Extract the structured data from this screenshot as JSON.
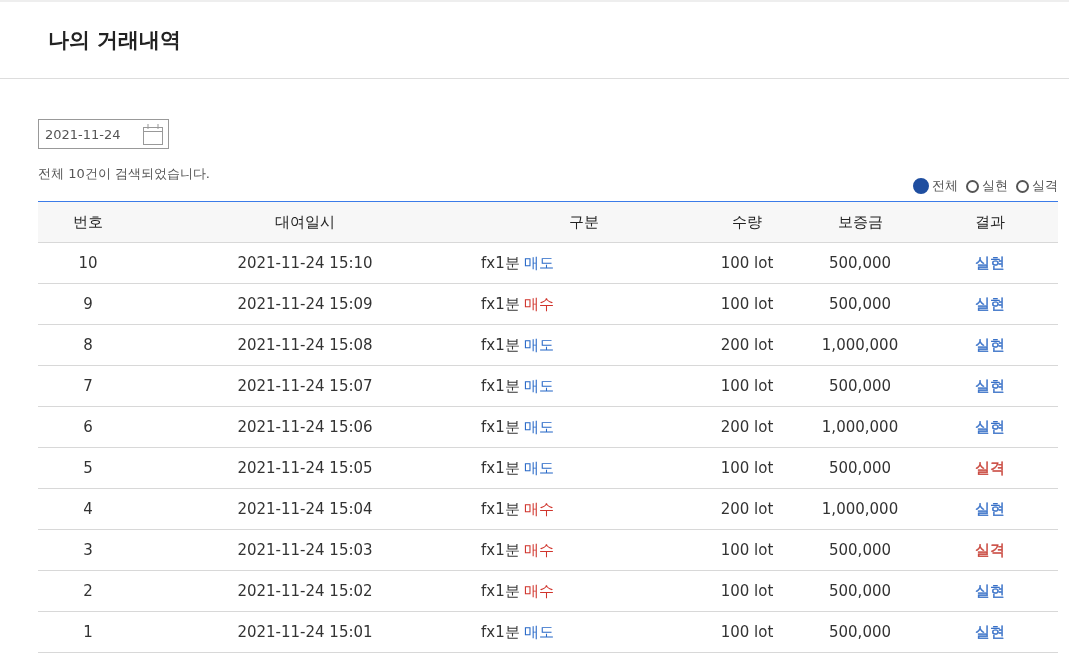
{
  "page_title": "나의 거래내역",
  "date_field": {
    "value": "2021-11-24"
  },
  "result_count": "전체 10건이 검색되었습니다.",
  "filters": [
    {
      "label": "전체",
      "selected": true
    },
    {
      "label": "실현",
      "selected": false
    },
    {
      "label": "실격",
      "selected": false
    }
  ],
  "table": {
    "columns": [
      "번호",
      "대여일시",
      "구분",
      "수량",
      "보증금",
      "결과"
    ],
    "rows": [
      {
        "no": "10",
        "datetime": "2021-11-24 15:10",
        "product": "fx1분",
        "side": {
          "text": "매도",
          "color": "#2a6ac8"
        },
        "quantity": "100 lot",
        "deposit": "500,000",
        "result": {
          "text": "실현",
          "color": "#3a72c8"
        }
      },
      {
        "no": "9",
        "datetime": "2021-11-24 15:09",
        "product": "fx1분",
        "side": {
          "text": "매수",
          "color": "#d0342c"
        },
        "quantity": "100 lot",
        "deposit": "500,000",
        "result": {
          "text": "실현",
          "color": "#3a72c8"
        }
      },
      {
        "no": "8",
        "datetime": "2021-11-24 15:08",
        "product": "fx1분",
        "side": {
          "text": "매도",
          "color": "#2a6ac8"
        },
        "quantity": "200 lot",
        "deposit": "1,000,000",
        "result": {
          "text": "실현",
          "color": "#3a72c8"
        }
      },
      {
        "no": "7",
        "datetime": "2021-11-24 15:07",
        "product": "fx1분",
        "side": {
          "text": "매도",
          "color": "#2a6ac8"
        },
        "quantity": "100 lot",
        "deposit": "500,000",
        "result": {
          "text": "실현",
          "color": "#3a72c8"
        }
      },
      {
        "no": "6",
        "datetime": "2021-11-24 15:06",
        "product": "fx1분",
        "side": {
          "text": "매도",
          "color": "#2a6ac8"
        },
        "quantity": "200 lot",
        "deposit": "1,000,000",
        "result": {
          "text": "실현",
          "color": "#3a72c8"
        }
      },
      {
        "no": "5",
        "datetime": "2021-11-24 15:05",
        "product": "fx1분",
        "side": {
          "text": "매도",
          "color": "#2a6ac8"
        },
        "quantity": "100 lot",
        "deposit": "500,000",
        "result": {
          "text": "실격",
          "color": "#c8443a"
        }
      },
      {
        "no": "4",
        "datetime": "2021-11-24 15:04",
        "product": "fx1분",
        "side": {
          "text": "매수",
          "color": "#d0342c"
        },
        "quantity": "200 lot",
        "deposit": "1,000,000",
        "result": {
          "text": "실현",
          "color": "#3a72c8"
        }
      },
      {
        "no": "3",
        "datetime": "2021-11-24 15:03",
        "product": "fx1분",
        "side": {
          "text": "매수",
          "color": "#d0342c"
        },
        "quantity": "100 lot",
        "deposit": "500,000",
        "result": {
          "text": "실격",
          "color": "#c8443a"
        }
      },
      {
        "no": "2",
        "datetime": "2021-11-24 15:02",
        "product": "fx1분",
        "side": {
          "text": "매수",
          "color": "#d0342c"
        },
        "quantity": "100 lot",
        "deposit": "500,000",
        "result": {
          "text": "실현",
          "color": "#3a72c8"
        }
      },
      {
        "no": "1",
        "datetime": "2021-11-24 15:01",
        "product": "fx1분",
        "side": {
          "text": "매도",
          "color": "#2a6ac8"
        },
        "quantity": "100 lot",
        "deposit": "500,000",
        "result": {
          "text": "실현",
          "color": "#3a72c8"
        }
      }
    ]
  }
}
